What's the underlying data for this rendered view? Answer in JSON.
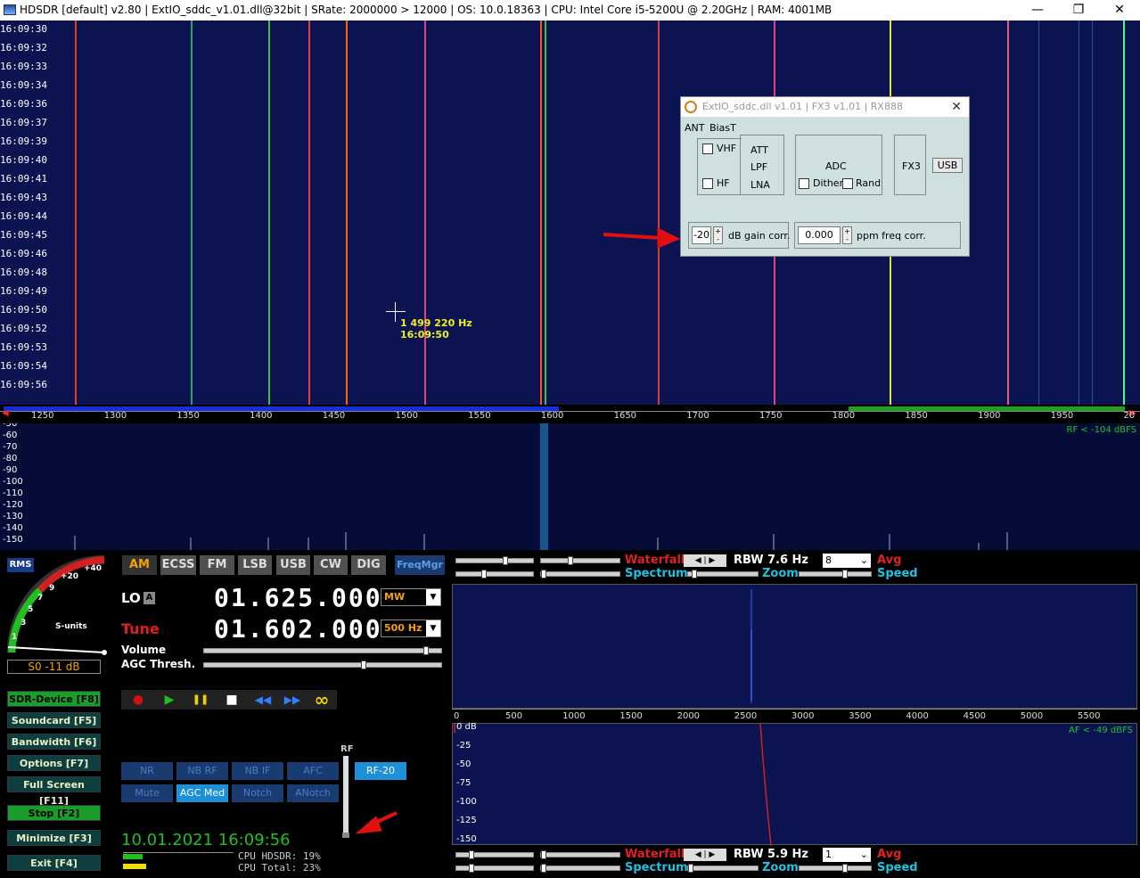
{
  "window": {
    "title": "HDSDR  [default]  v2.80   |  ExtIO_sddc_v1.01.dll@32bit  |  SRate: 2000000 > 12000  |  OS: 10.0.18363  |  CPU: Intel Core i5-5200U @ 2.20GHz  |  RAM: 4001MB",
    "minimize": "—",
    "restore": "❐",
    "close": "✕"
  },
  "waterfall": {
    "timestamps": [
      "16:09:30",
      "16:09:32",
      "16:09:33",
      "16:09:34",
      "16:09:36",
      "16:09:37",
      "16:09:39",
      "16:09:40",
      "16:09:41",
      "16:09:43",
      "16:09:44",
      "16:09:45",
      "16:09:46",
      "16:09:48",
      "16:09:49",
      "16:09:50",
      "16:09:52",
      "16:09:53",
      "16:09:54",
      "16:09:56"
    ],
    "cursor_freq": "1 499 220 Hz",
    "cursor_time": "16:09:50"
  },
  "freq_axis": {
    "ticks": [
      "1250",
      "1300",
      "1350",
      "1400",
      "1450",
      "1500",
      "1550",
      "1600",
      "1650",
      "1700",
      "1750",
      "1800",
      "1850",
      "1900",
      "1950",
      "20"
    ]
  },
  "spectrum": {
    "db_labels": [
      "-50",
      "-60",
      "-70",
      "-80",
      "-90",
      "-100",
      "-110",
      "-120",
      "-130",
      "-140",
      "-150"
    ],
    "rf_readout": "RF < -104 dBFS"
  },
  "smeter": {
    "rms_label": "RMS",
    "scale": [
      "1",
      "3",
      "5",
      "7",
      "9",
      "+20",
      "+40"
    ],
    "units": "S-units",
    "reading": "S0 -11 dB"
  },
  "sidebar": {
    "buttons": [
      {
        "label": "SDR-Device [F8]"
      },
      {
        "label": "Soundcard  [F5]"
      },
      {
        "label": "Bandwidth  [F6]"
      },
      {
        "label": "Options    [F7]"
      },
      {
        "label": "Full Screen [F11]"
      },
      {
        "label": "Stop       [F2]"
      },
      {
        "label": "Minimize  [F3]"
      },
      {
        "label": "Exit       [F4]"
      }
    ]
  },
  "modes": [
    "AM",
    "ECSS",
    "FM",
    "LSB",
    "USB",
    "CW",
    "DIG"
  ],
  "freqmgr": "FreqMgr",
  "lo": {
    "label": "LO",
    "badge": "A",
    "freq": "01.625.000",
    "band": "MW"
  },
  "tune": {
    "label": "Tune",
    "freq": "01.602.000",
    "step": "500 Hz"
  },
  "volume_label": "Volume",
  "agc_label": "AGC Thresh.",
  "dsp": {
    "row1": [
      "NR",
      "NB RF",
      "NB IF",
      "AFC"
    ],
    "row2": [
      "Mute",
      "AGC Med",
      "Notch",
      "ANotch"
    ],
    "rf_btn": "RF-20",
    "rf_label": "RF"
  },
  "transport": [
    "●",
    "▶",
    "❚❚",
    "■",
    "◀◀",
    "▶▶",
    "∞"
  ],
  "datetime": "10.01.2021 16:09:56",
  "cpu": {
    "hdsdr": "CPU HDSDR: 19%",
    "total": "CPU Total: 23%"
  },
  "rf_controls": {
    "waterfall": "Waterfall",
    "spectrum": "Spectrum",
    "rbw_label": "RBW",
    "rbw": "7.6 Hz",
    "avg_value": "8",
    "avg": "Avg",
    "zoom": "Zoom",
    "speed": "Speed"
  },
  "af_axis": {
    "ticks": [
      "0",
      "500",
      "1000",
      "1500",
      "2000",
      "2500",
      "3000",
      "3500",
      "4000",
      "4500",
      "5000",
      "5500"
    ]
  },
  "af_plot": {
    "db_labels": [
      "0 dB",
      "-25",
      "-50",
      "-75",
      "-100",
      "-125",
      "-150"
    ],
    "af_readout": "AF < -49 dBFS"
  },
  "af_controls": {
    "waterfall": "Waterfall",
    "spectrum": "Spectrum",
    "rbw_label": "RBW",
    "rbw": "5.9 Hz",
    "avg_value": "1",
    "avg": "Avg",
    "zoom": "Zoom",
    "speed": "Speed"
  },
  "dialog": {
    "title": "ExtIO_sddc.dll v1.01  |  FX3 v1.01  |  RX888",
    "ant": "ANT",
    "biast": "BiasT",
    "vhf": "VHF",
    "hf": "HF",
    "att": "ATT",
    "lpf": "LPF",
    "lna": "LNA",
    "adc": "ADC",
    "dither": "Dither",
    "rand": "Rand",
    "fx3": "FX3",
    "usb": "USB",
    "gain_value": "-20",
    "gain_label": "dB gain corr.",
    "ppm_value": "0.000",
    "ppm_label": "ppm freq corr."
  },
  "colors": {
    "accent": "#f5a100",
    "rf_green": "#22c022",
    "wf_bg": "#0b1450"
  }
}
